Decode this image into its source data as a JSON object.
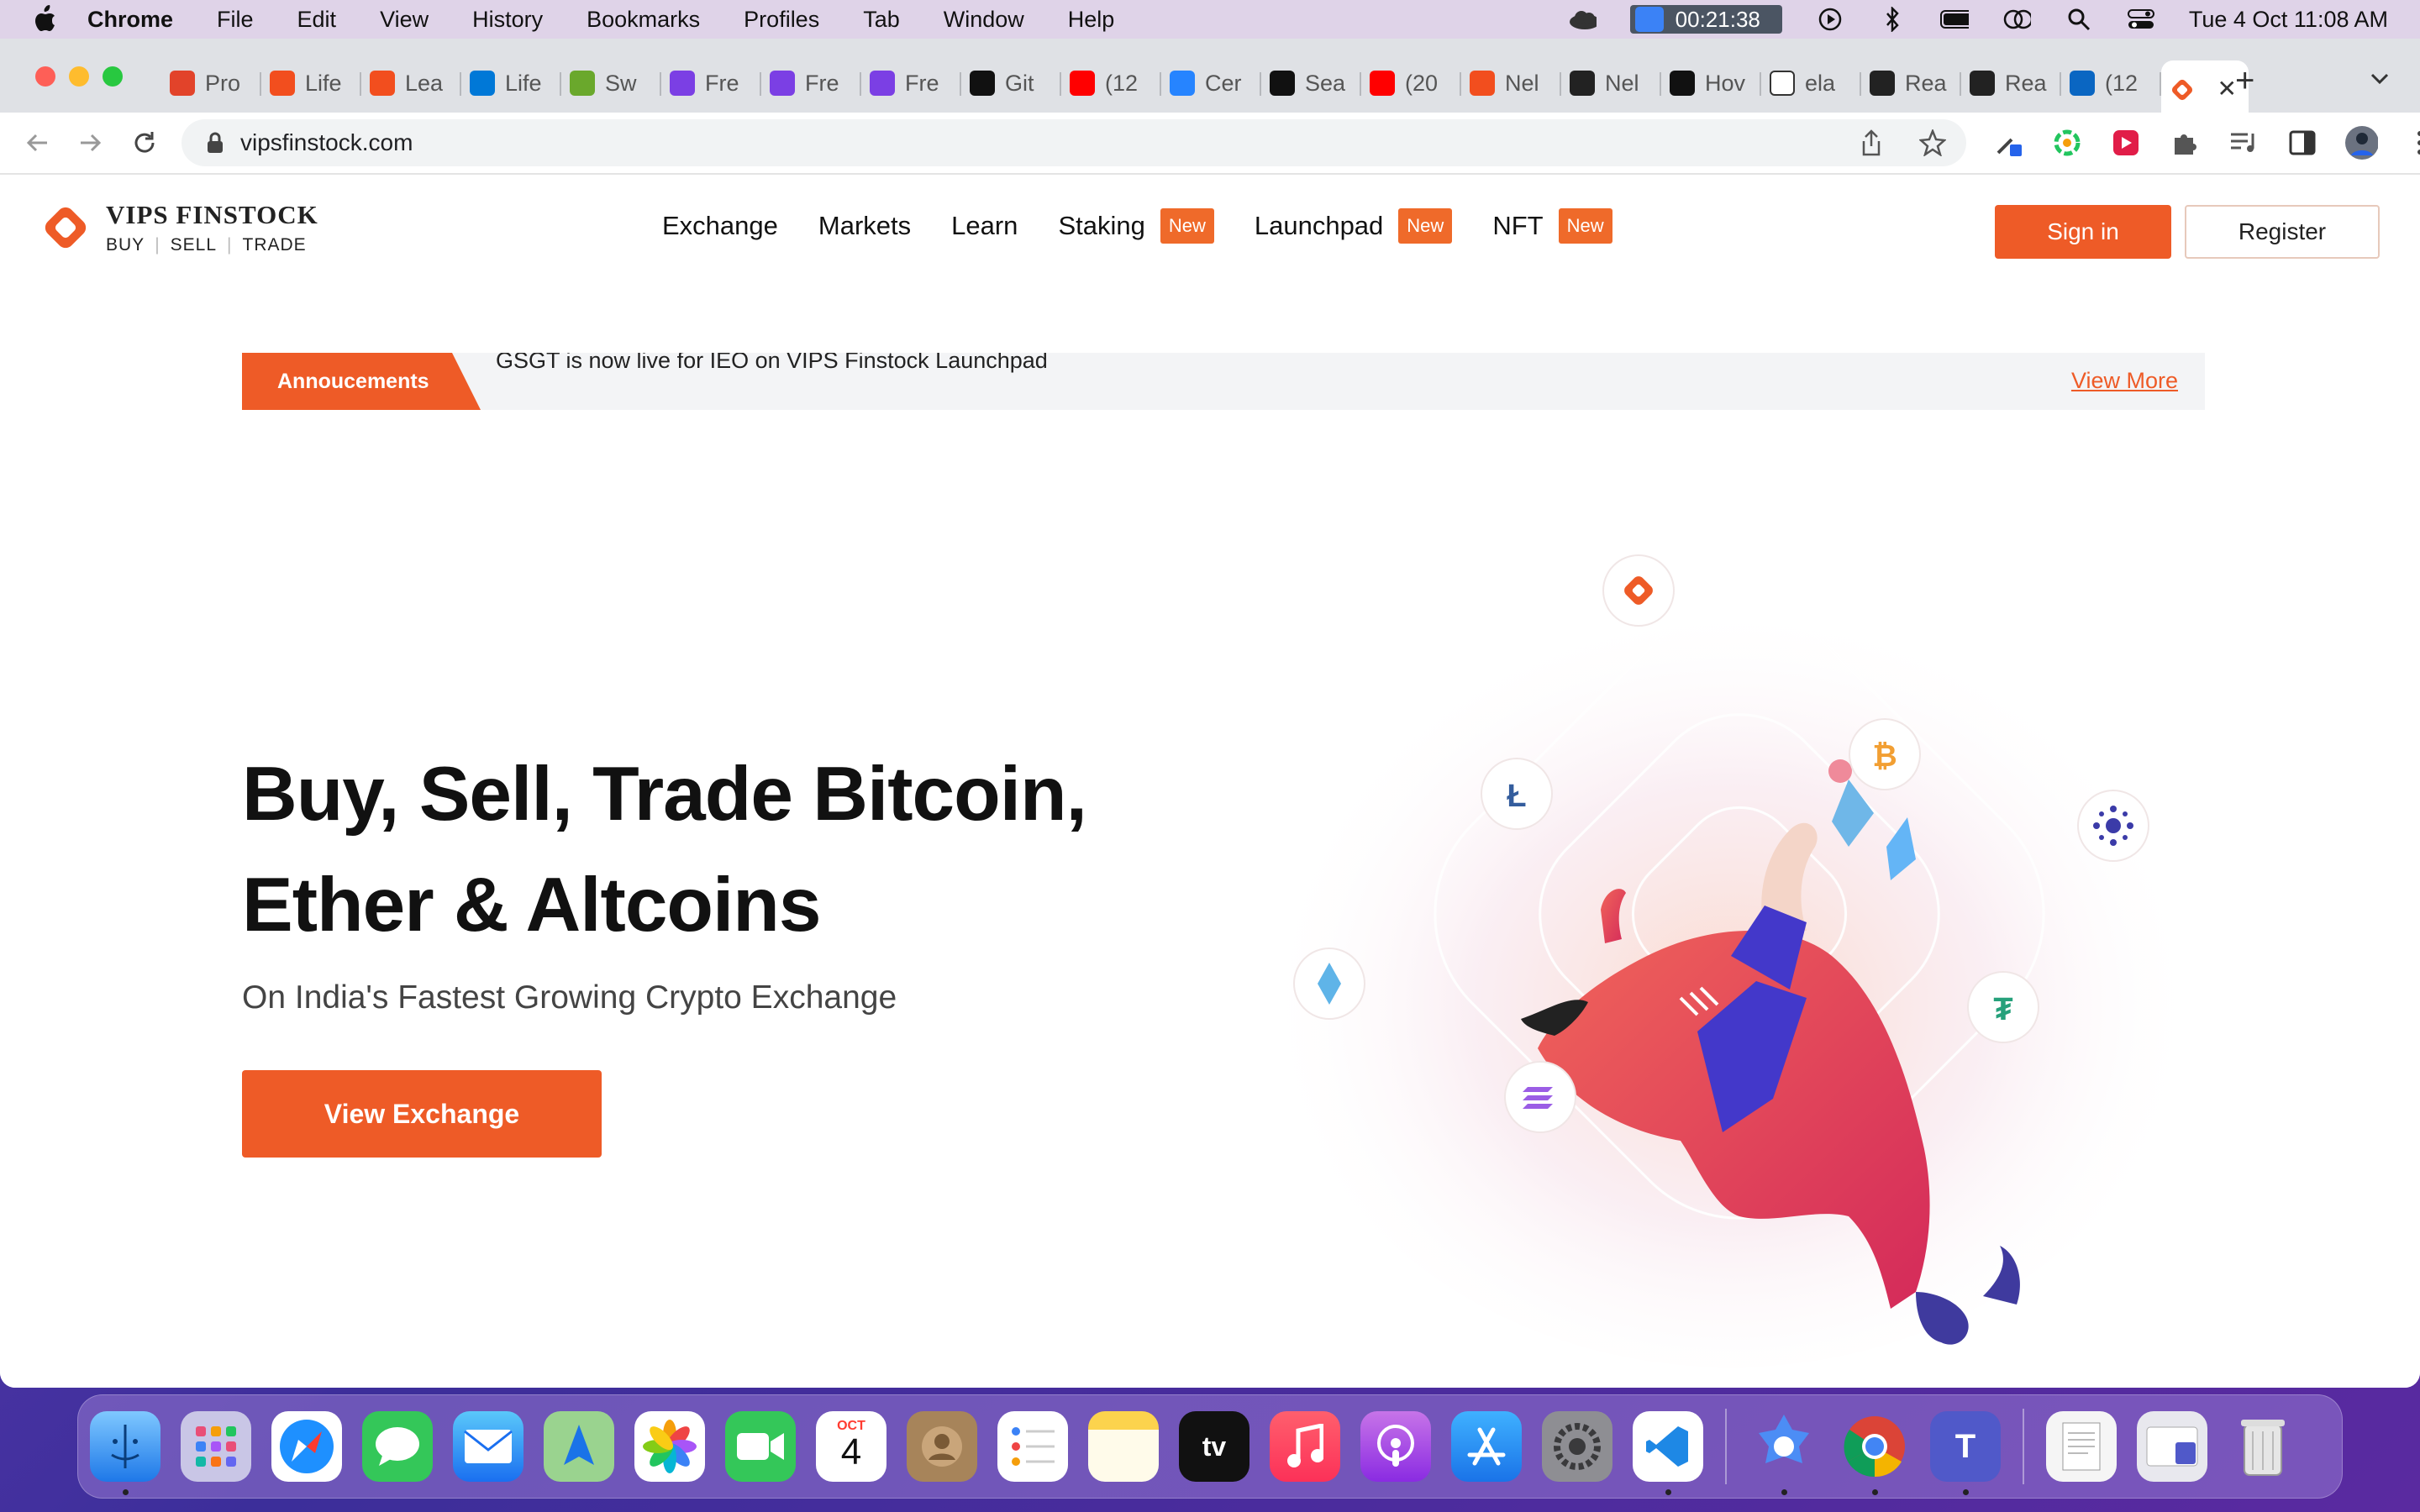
{
  "menubar": {
    "app_name": "Chrome",
    "menus": [
      "File",
      "Edit",
      "View",
      "History",
      "Bookmarks",
      "Profiles",
      "Tab",
      "Window",
      "Help"
    ],
    "timer": "00:21:38",
    "datetime": "Tue 4 Oct  11:08 AM"
  },
  "tabs": [
    {
      "label": "Pro",
      "icon": "gitlab-icon",
      "color": "#e2432a"
    },
    {
      "label": "Life",
      "icon": "figma-icon",
      "color": "#f24e1e"
    },
    {
      "label": "Lea",
      "icon": "figma-icon",
      "color": "#f24e1e"
    },
    {
      "label": "Life",
      "icon": "azure-devops-icon",
      "color": "#0078d7"
    },
    {
      "label": "Sw",
      "icon": "swagger-icon",
      "color": "#6aa82c"
    },
    {
      "label": "Fre",
      "icon": "freshworks-icon",
      "color": "#7b3fe4"
    },
    {
      "label": "Fre",
      "icon": "freshworks-icon",
      "color": "#7b3fe4"
    },
    {
      "label": "Fre",
      "icon": "freshworks-icon",
      "color": "#7b3fe4"
    },
    {
      "label": "Git",
      "icon": "github-icon",
      "color": "#111111"
    },
    {
      "label": "(12",
      "icon": "youtube-icon",
      "color": "#ff0000"
    },
    {
      "label": "Cer",
      "icon": "confluence-icon",
      "color": "#2684ff"
    },
    {
      "label": "Sea",
      "icon": "nextjs-icon",
      "color": "#111111"
    },
    {
      "label": "(20",
      "icon": "youtube-icon",
      "color": "#ff0000"
    },
    {
      "label": "Nel",
      "icon": "figma-icon",
      "color": "#f24e1e"
    },
    {
      "label": "Nel",
      "icon": "react-icon",
      "color": "#222222"
    },
    {
      "label": "Hov",
      "icon": "nextjs-icon",
      "color": "#111111"
    },
    {
      "label": "ela",
      "icon": "blank-page-icon",
      "color": "#ffffff"
    },
    {
      "label": "Rea",
      "icon": "react-icon",
      "color": "#222222"
    },
    {
      "label": "Rea",
      "icon": "react-icon",
      "color": "#222222"
    },
    {
      "label": "(12",
      "icon": "linkedin-icon",
      "color": "#0a66c2"
    }
  ],
  "active_tab": {
    "icon": "vips-logo-icon"
  },
  "address_bar": {
    "url": "vipsfinstock.com"
  },
  "site": {
    "brand": "VIPS FINSTOCK",
    "tagline": [
      "BUY",
      "SELL",
      "TRADE"
    ],
    "nav": [
      {
        "label": "Exchange",
        "badge": ""
      },
      {
        "label": "Markets",
        "badge": ""
      },
      {
        "label": "Learn",
        "badge": ""
      },
      {
        "label": "Staking",
        "badge": "New"
      },
      {
        "label": "Launchpad",
        "badge": "New"
      },
      {
        "label": "NFT",
        "badge": "New"
      }
    ],
    "signin_label": "Sign in",
    "register_label": "Register",
    "announcement": {
      "flag": "Annoucements",
      "message": "GSGT is now live for IEO on VIPS Finstock Launchpad",
      "view_more": "View More"
    },
    "hero": {
      "title_line1": "Buy, Sell, Trade Bitcoin,",
      "title_line2": "Ether & Altcoins",
      "subtitle": "On India's Fastest Growing Crypto Exchange",
      "cta": "View Exchange"
    },
    "accent_color": "#ee5b27"
  },
  "dock": {
    "calendar_month": "OCT",
    "calendar_day": "4",
    "apps": [
      "finder",
      "launchpad",
      "safari",
      "messages",
      "mail",
      "maps",
      "photos",
      "facetime",
      "calendar",
      "contacts",
      "reminders",
      "notes",
      "apple-tv",
      "music",
      "podcasts",
      "app-store",
      "system-preferences",
      "vscode",
      "rocket",
      "chrome",
      "teams",
      "documents",
      "downloads",
      "trash"
    ]
  }
}
